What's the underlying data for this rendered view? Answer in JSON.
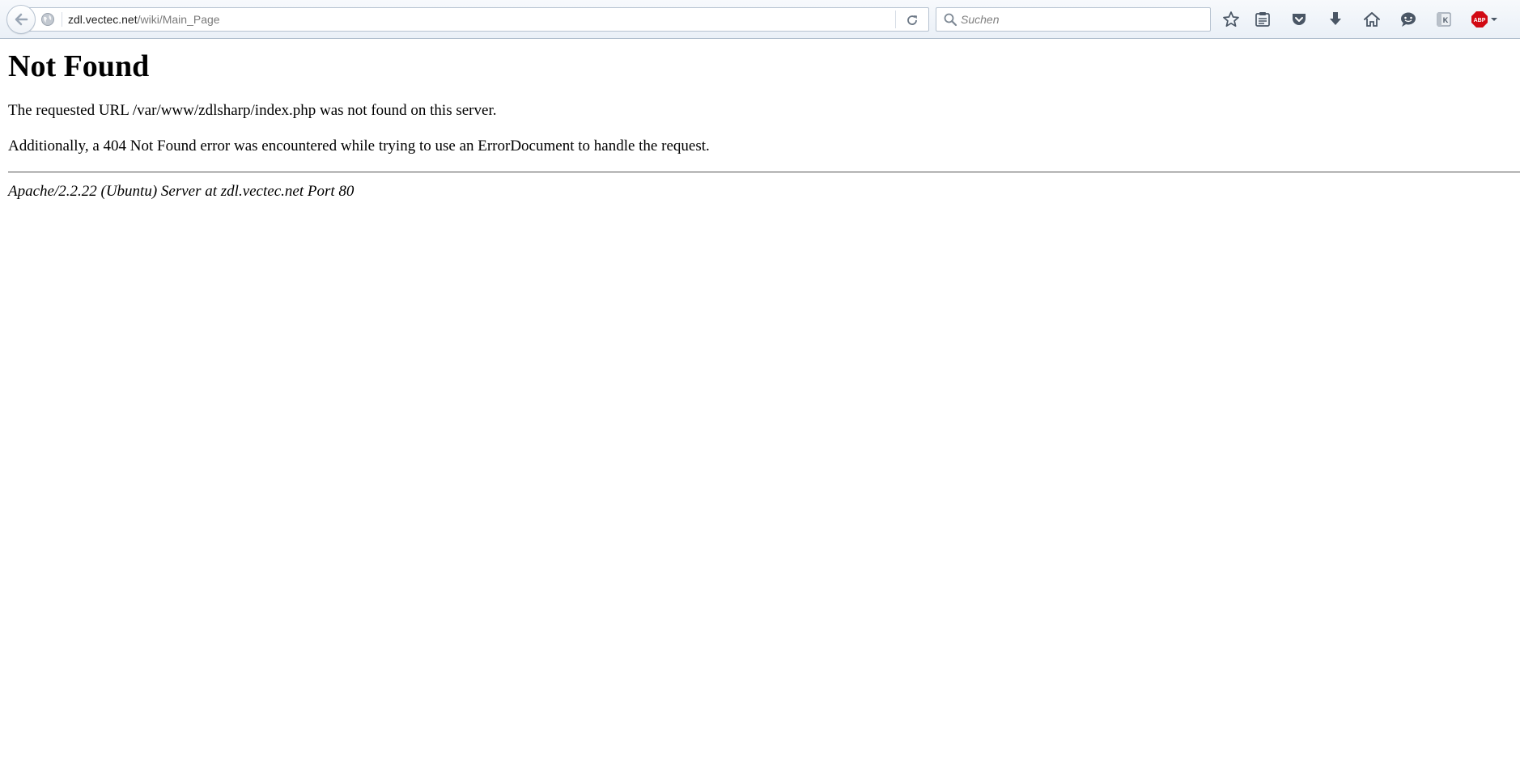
{
  "toolbar": {
    "url": {
      "host": "zdl.vectec.net",
      "path": "/wiki/Main_Page"
    },
    "search": {
      "placeholder": "Suchen"
    },
    "buttons": [
      "star-icon",
      "reading-list-icon",
      "pocket-icon",
      "download-icon",
      "home-icon",
      "chat-icon",
      "k-extension-icon",
      "adblock-plus-icon"
    ],
    "adblock_label": "ABP",
    "k_label": "K",
    "colors": {
      "toolbar_bg": "#eaf0f7",
      "icon_gray": "#5d6a7b",
      "abp_red": "#d10a14"
    }
  },
  "page": {
    "title": "Not Found",
    "message": "The requested URL /var/www/zdlsharp/index.php was not found on this server.",
    "additional": "Additionally, a 404 Not Found error was encountered while trying to use an ErrorDocument to handle the request.",
    "server_signature": "Apache/2.2.22 (Ubuntu) Server at zdl.vectec.net Port 80"
  }
}
